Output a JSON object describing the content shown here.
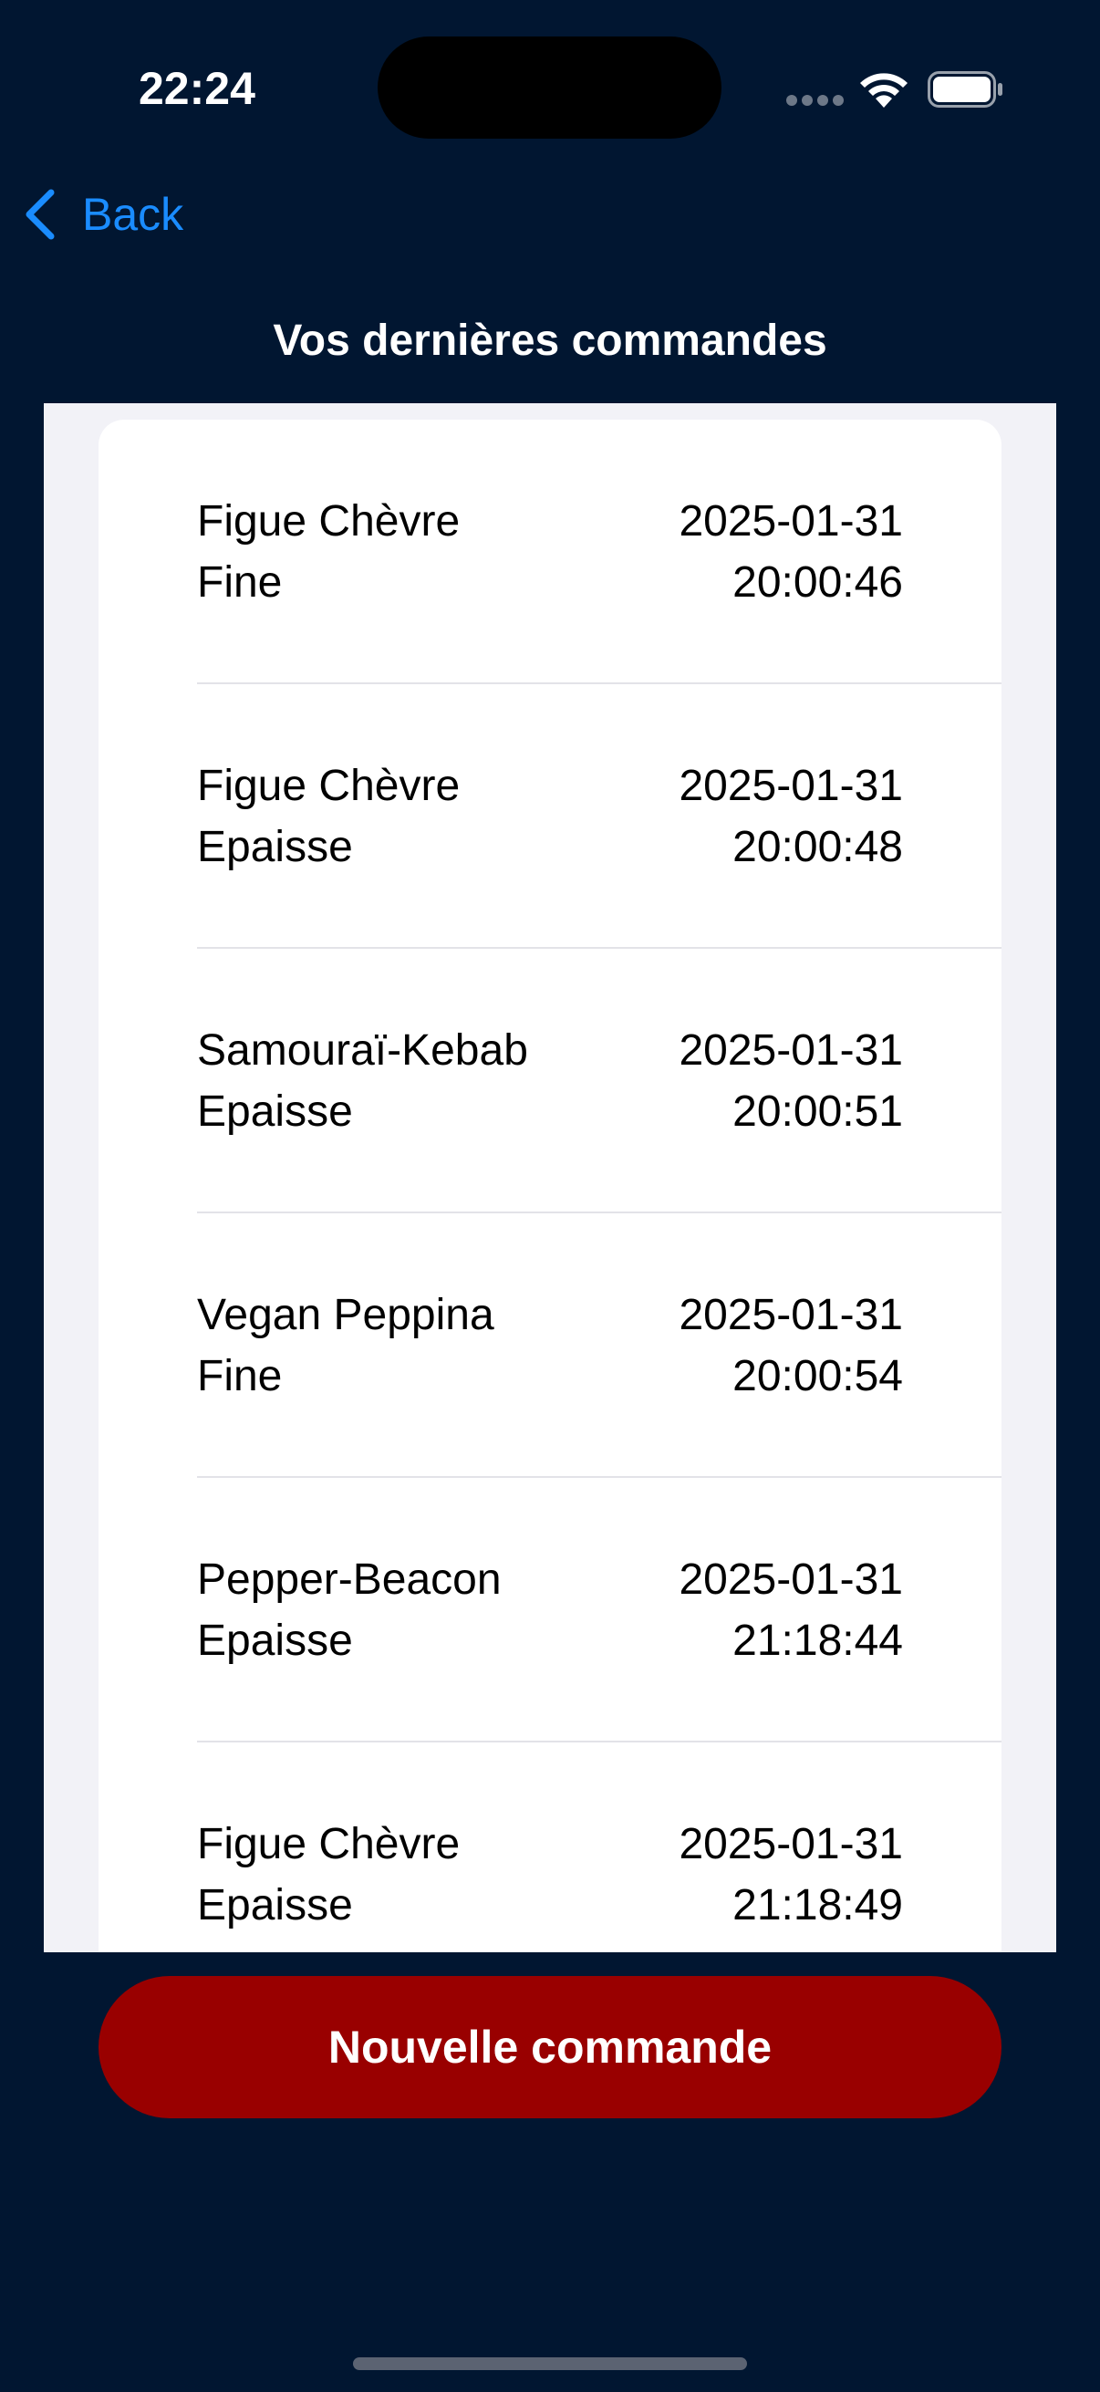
{
  "status_bar": {
    "time": "22:24"
  },
  "nav": {
    "back_label": "Back",
    "title": "Vos dernières commandes"
  },
  "orders": [
    {
      "name": "Figue Chèvre",
      "crust": "Fine",
      "date": "2025-01-31",
      "time": "20:00:46"
    },
    {
      "name": "Figue Chèvre",
      "crust": "Epaisse",
      "date": "2025-01-31",
      "time": "20:00:48"
    },
    {
      "name": "Samouraï-Kebab",
      "crust": "Epaisse",
      "date": "2025-01-31",
      "time": "20:00:51"
    },
    {
      "name": "Vegan Peppina",
      "crust": "Fine",
      "date": "2025-01-31",
      "time": "20:00:54"
    },
    {
      "name": "Pepper-Beacon",
      "crust": "Epaisse",
      "date": "2025-01-31",
      "time": "21:18:44"
    },
    {
      "name": "Figue Chèvre",
      "crust": "Epaisse",
      "date": "2025-01-31",
      "time": "21:18:49"
    }
  ],
  "actions": {
    "new_order_label": "Nouvelle commande"
  },
  "colors": {
    "background": "#011631",
    "accent": "#1a8cff",
    "button": "#990000"
  }
}
